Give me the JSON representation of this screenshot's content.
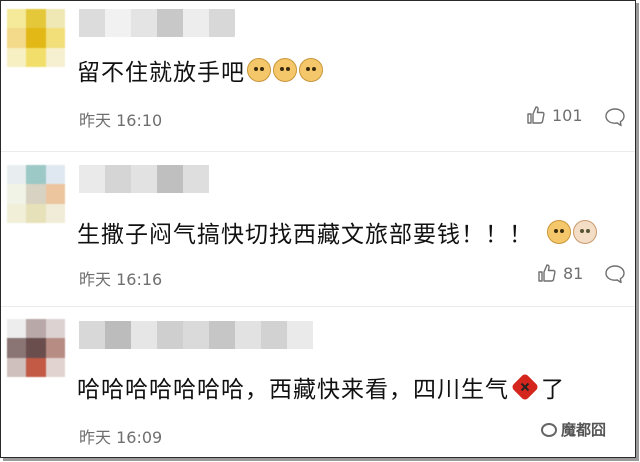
{
  "comments": [
    {
      "text": "留不住就放手吧",
      "emojis": [
        "doge-icon",
        "doge-icon",
        "doge-icon"
      ],
      "time": "昨天 16:10",
      "likes": "101",
      "avatar_colors": [
        "#f4ea9a",
        "#e5c73a",
        "#efe8b5",
        "#f3d98a",
        "#e2b817",
        "#f2df7a",
        "#f7f0c2",
        "#f2df6b",
        "#f6efd0"
      ],
      "name_colors": [
        "#dcdcdc",
        "#f1f1f1",
        "#e4e4e4",
        "#c8c8c8",
        "#ededed",
        "#d8d8d8"
      ]
    },
    {
      "text": "生撒子闷气搞快切找西藏文旅部要钱！！！",
      "emojis": [
        "doge-icon",
        "cat-icon"
      ],
      "time": "昨天 16:16",
      "likes": "81",
      "avatar_colors": [
        "#e8eef0",
        "#9cc8c5",
        "#dfe8f0",
        "#f0f3e6",
        "#d8d2c2",
        "#ecc59f",
        "#f1efd8",
        "#e6e1b8",
        "#f0ecd8"
      ],
      "name_colors": [
        "#eaeaea",
        "#d5d5d5",
        "#e2e2e2",
        "#bfbfbf",
        "#dedede"
      ]
    },
    {
      "text": "哈哈哈哈哈哈哈，西藏快来看，四川生气",
      "text_tail": "了",
      "emojis": [
        "angry-icon"
      ],
      "time": "昨天 16:09",
      "avatar_colors": [
        "#ededed",
        "#b9a8a8",
        "#dcd2d2",
        "#8a7474",
        "#6a4e4e",
        "#b78d83",
        "#cfc0bd",
        "#c25a45",
        "#e0d3d0"
      ],
      "name_colors": [
        "#d8d8d8",
        "#bcbcbc",
        "#e6e6e6",
        "#cfcfcf",
        "#dadada",
        "#c6c6c6",
        "#e2e2e2",
        "#d2d2d2",
        "#eaeaea"
      ],
      "watermark": "魔都囧"
    }
  ],
  "colors": {
    "text": "#111111",
    "meta": "#6f6f6f",
    "divider": "#ececec"
  }
}
